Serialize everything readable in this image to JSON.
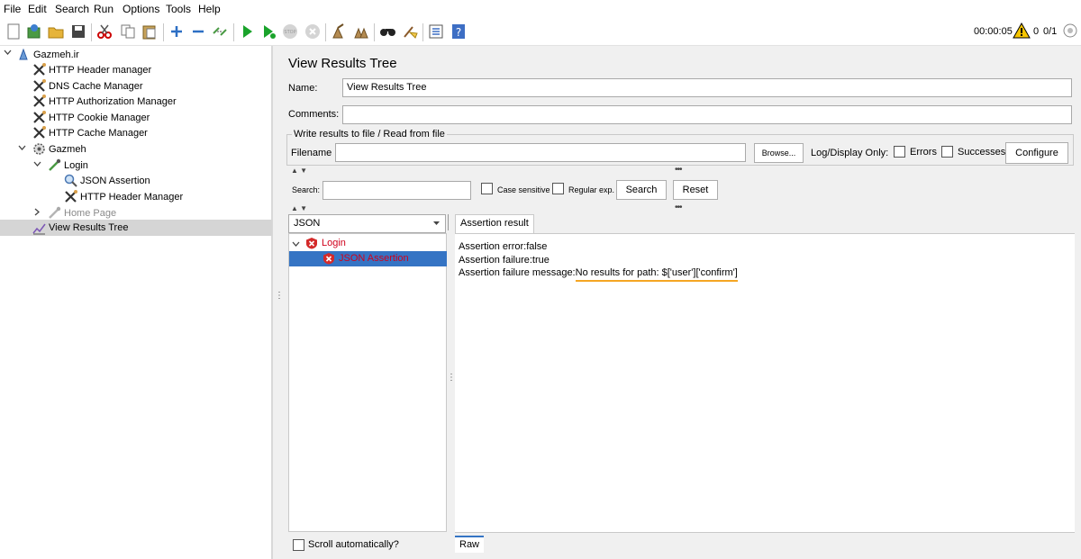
{
  "menu": [
    "File",
    "Edit",
    "Search",
    "Run",
    "Options",
    "Tools",
    "Help"
  ],
  "toolbar": {
    "timer": "00:00:05",
    "warning_count": "0",
    "threads": "0/1",
    "icons": [
      "new-icon",
      "templates-icon",
      "open-icon",
      "save-icon",
      "cut-icon",
      "copy-icon",
      "paste-icon",
      "expand-icon",
      "collapse-icon",
      "toggle-icon",
      "start-icon",
      "start-no-pause-icon",
      "stop-icon",
      "shutdown-icon",
      "clear-icon",
      "clear-all-icon",
      "search-icon",
      "reset-search-icon",
      "function-helper-icon",
      "help-icon"
    ]
  },
  "tree": {
    "root": "Gazmeh.ir",
    "items": [
      "HTTP Header manager",
      "DNS Cache Manager",
      "HTTP Authorization Manager",
      "HTTP Cookie Manager",
      "HTTP Cache Manager",
      "Gazmeh",
      "Login",
      "JSON Assertion",
      "HTTP Header Manager",
      "Home Page",
      "View Results Tree"
    ]
  },
  "panel": {
    "title": "View Results Tree",
    "name_label": "Name:",
    "name_value": "View Results Tree",
    "comments_label": "Comments:",
    "comments_value": "",
    "file_group_legend": "Write results to file / Read from file",
    "filename_label": "Filename",
    "filename_value": "",
    "browse_label": "Browse...",
    "log_display_label": "Log/Display Only:",
    "errors_label": "Errors",
    "successes_label": "Successes",
    "configure_label": "Configure"
  },
  "search": {
    "label": "Search:",
    "value": "",
    "case_sensitive_label": "Case sensitive",
    "regex_label": "Regular exp.",
    "search_button": "Search",
    "reset_button": "Reset"
  },
  "results": {
    "renderer": "JSON",
    "samples": [
      "Login",
      "JSON Assertion"
    ],
    "tab": "Assertion result",
    "lines": [
      "Assertion error:false",
      "Assertion failure:true",
      "Assertion failure message:"
    ],
    "failure_message": "No results for path: $['user']['confirm']",
    "scroll_auto_label": "Scroll automatically?",
    "raw_tab": "Raw"
  },
  "colors": {
    "selection": "#3574c4",
    "error_red": "#d0011b",
    "highlight_underline": "#f5a623"
  }
}
